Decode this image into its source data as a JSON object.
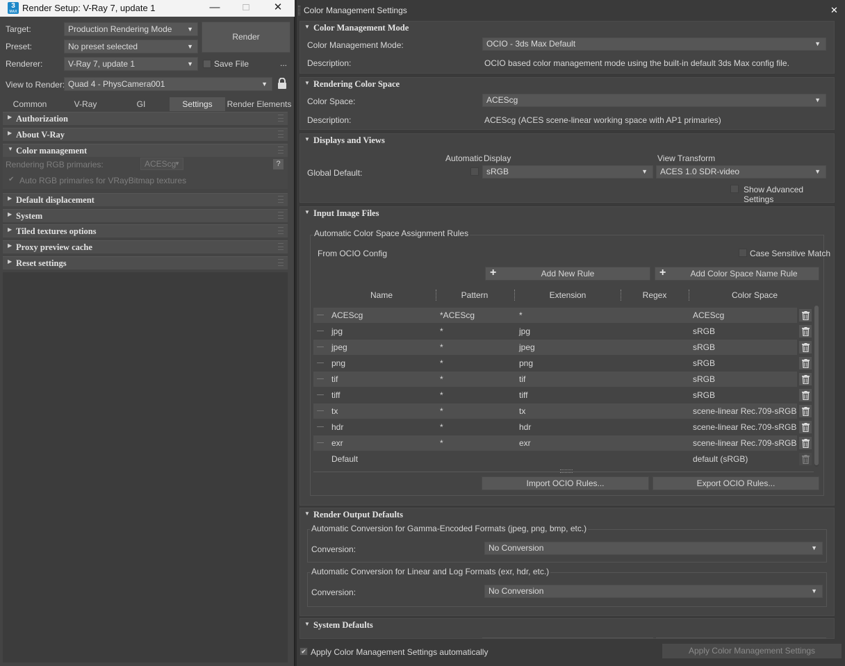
{
  "left": {
    "window_title": "Render Setup: V-Ray 7, update 1",
    "app_icon_text": "3",
    "app_icon_sub": "MAX",
    "controls": {
      "minimize": "—",
      "maximize": "□",
      "close": "✕"
    },
    "target_label": "Target:",
    "target_value": "Production Rendering Mode",
    "preset_label": "Preset:",
    "preset_value": "No preset selected",
    "renderer_label": "Renderer:",
    "renderer_value": "V-Ray 7, update 1",
    "save_file_label": "Save File",
    "more_label": "...",
    "render_button": "Render",
    "view_label": "View to Render:",
    "view_value": "Quad 4 - PhysCamera001",
    "tabs": [
      "Common",
      "V-Ray",
      "GI",
      "Settings",
      "Render Elements"
    ],
    "active_tab": "Settings",
    "rollouts": {
      "authorization": "Authorization",
      "about": "About V-Ray",
      "color_management": "Color management",
      "default_displacement": "Default displacement",
      "system": "System",
      "tiled_textures": "Tiled textures options",
      "proxy_preview": "Proxy preview cache",
      "reset_settings": "Reset settings"
    },
    "rgb_primaries_label": "Rendering RGB primaries:",
    "rgb_primaries_value": "ACEScg",
    "help_label": "?",
    "auto_rgb_label": "Auto RGB primaries for VRayBitmap textures"
  },
  "right": {
    "window_title": "Color Management Settings",
    "close": "✕",
    "cm_mode": {
      "header": "Color Management Mode",
      "mode_label": "Color Management Mode:",
      "mode_value": "OCIO - 3ds Max Default",
      "desc_label": "Description:",
      "desc_value": "OCIO based color management mode using the built-in default 3ds Max config file."
    },
    "rendering_cs": {
      "header": "Rendering Color Space",
      "cs_label": "Color Space:",
      "cs_value": "ACEScg",
      "desc_label": "Description:",
      "desc_value": "ACEScg (ACES scene-linear working space with AP1 primaries)"
    },
    "displays": {
      "header": "Displays and Views",
      "automatic_label": "Automatic",
      "display_label": "Display",
      "view_transform_label": "View Transform",
      "global_default_label": "Global Default:",
      "display_value": "sRGB",
      "view_transform_value": "ACES 1.0 SDR-video",
      "advanced_label": "Show Advanced Settings"
    },
    "input_files": {
      "header": "Input Image Files",
      "legend": "Automatic Color Space Assignment Rules",
      "from_ocio": "From OCIO Config",
      "case_sensitive": "Case Sensitive Match",
      "add_rule": "Add New Rule",
      "add_name_rule": "Add Color Space Name Rule",
      "columns": [
        "Name",
        "Pattern",
        "Extension",
        "Regex",
        "Color Space"
      ],
      "rows": [
        {
          "name": "ACEScg",
          "pattern": "*ACEScg",
          "ext": "*",
          "cs": "ACEScg"
        },
        {
          "name": "jpg",
          "pattern": "*",
          "ext": "jpg",
          "cs": "sRGB"
        },
        {
          "name": "jpeg",
          "pattern": "*",
          "ext": "jpeg",
          "cs": "sRGB"
        },
        {
          "name": "png",
          "pattern": "*",
          "ext": "png",
          "cs": "sRGB"
        },
        {
          "name": "tif",
          "pattern": "*",
          "ext": "tif",
          "cs": "sRGB"
        },
        {
          "name": "tiff",
          "pattern": "*",
          "ext": "tiff",
          "cs": "sRGB"
        },
        {
          "name": "tx",
          "pattern": "*",
          "ext": "tx",
          "cs": "scene-linear Rec.709-sRGB"
        },
        {
          "name": "hdr",
          "pattern": "*",
          "ext": "hdr",
          "cs": "scene-linear Rec.709-sRGB"
        },
        {
          "name": "exr",
          "pattern": "*",
          "ext": "exr",
          "cs": "scene-linear Rec.709-sRGB"
        },
        {
          "name": "Default",
          "pattern": "",
          "ext": "",
          "cs": "default (sRGB)"
        }
      ],
      "import_rules": "Import OCIO Rules...",
      "export_rules": "Export OCIO Rules..."
    },
    "output_defaults": {
      "header": "Render Output Defaults",
      "gamma_legend": "Automatic Conversion for Gamma-Encoded Formats (jpeg, png, bmp, etc.)",
      "gamma_conv_label": "Conversion:",
      "gamma_conv_value": "No Conversion",
      "linear_legend": "Automatic Conversion for Linear and Log Formats (exr, hdr, etc.)",
      "linear_conv_label": "Conversion:",
      "linear_conv_value": "No Conversion"
    },
    "system_defaults": {
      "header": "System Defaults"
    },
    "apply_auto_label": "Apply Color Management Settings automatically",
    "apply_button": "Apply Color Management Settings"
  }
}
